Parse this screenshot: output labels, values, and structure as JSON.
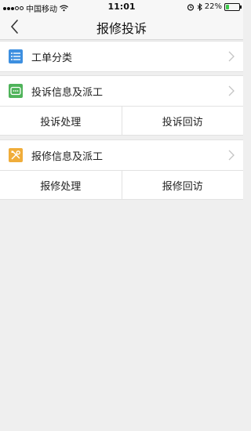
{
  "status": {
    "carrier": "中国移动",
    "time": "11:01",
    "battery": "22%",
    "battery_level": 0.22
  },
  "nav": {
    "title": "报修投诉"
  },
  "menu": {
    "order_category": {
      "label": "工单分类",
      "icon": "list-icon"
    },
    "complaint": {
      "label": "投诉信息及派工",
      "icon": "message-icon",
      "actions": [
        "投诉处理",
        "投诉回访"
      ]
    },
    "repair": {
      "label": "报修信息及派工",
      "icon": "tools-icon",
      "actions": [
        "报修处理",
        "报修回访"
      ]
    }
  },
  "colors": {
    "blue_icon": "#3d8fe0",
    "green_icon": "#4fb35a",
    "orange_icon": "#f0ad3a",
    "battery": "#3cc84a"
  }
}
